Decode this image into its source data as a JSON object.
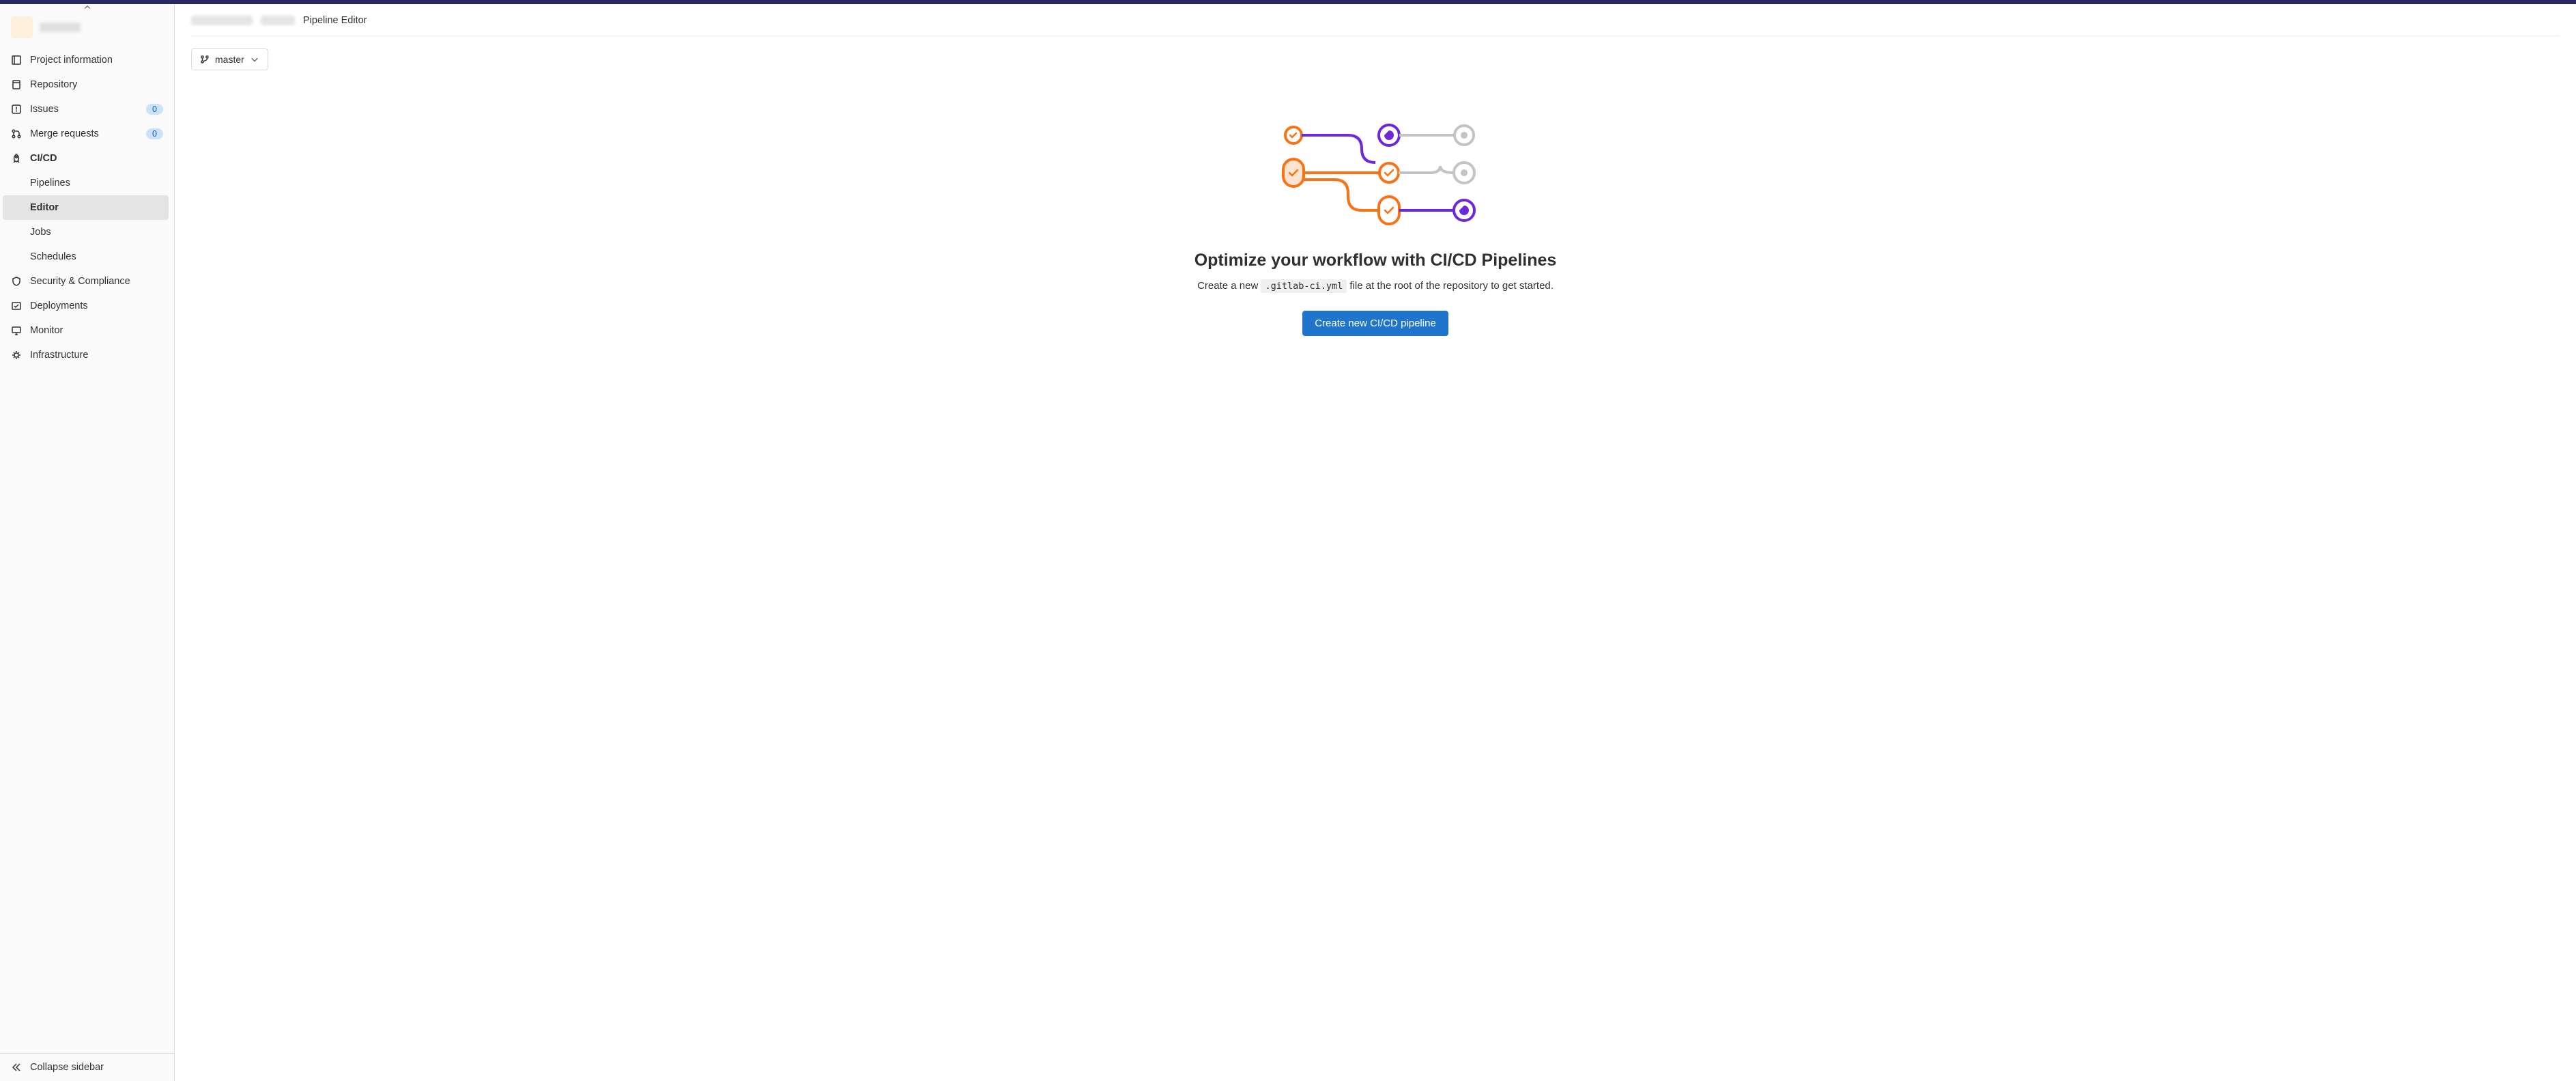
{
  "sidebar": {
    "items": [
      {
        "label": "Project information"
      },
      {
        "label": "Repository"
      },
      {
        "label": "Issues",
        "badge": "0"
      },
      {
        "label": "Merge requests",
        "badge": "0"
      },
      {
        "label": "CI/CD",
        "active": true
      },
      {
        "label": "Security & Compliance"
      },
      {
        "label": "Deployments"
      },
      {
        "label": "Monitor"
      },
      {
        "label": "Infrastructure"
      }
    ],
    "cicd_sub": [
      {
        "label": "Pipelines"
      },
      {
        "label": "Editor",
        "selected": true
      },
      {
        "label": "Jobs"
      },
      {
        "label": "Schedules"
      }
    ],
    "collapse_label": "Collapse sidebar"
  },
  "breadcrumb": {
    "current": "Pipeline Editor"
  },
  "branch_selector": {
    "branch": "master"
  },
  "empty_state": {
    "title": "Optimize your workflow with CI/CD Pipelines",
    "desc_prefix": "Create a new ",
    "desc_code": ".gitlab-ci.yml",
    "desc_suffix": " file at the root of the repository to get started.",
    "button": "Create new CI/CD pipeline"
  }
}
